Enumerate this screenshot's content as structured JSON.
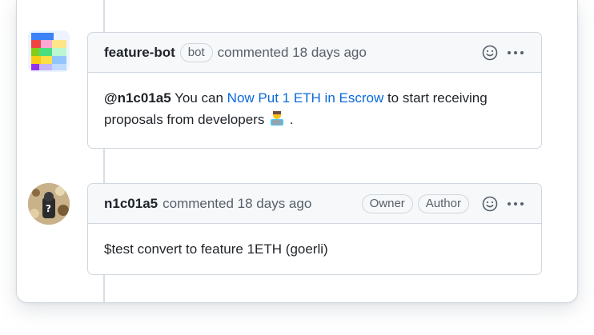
{
  "comments": [
    {
      "author": "feature-bot",
      "author_badge": "bot",
      "meta": "commented 18 days ago",
      "body": {
        "mention": "@n1c01a5",
        "text_before_link": " You can ",
        "link_text": "Now Put 1 ETH in Escrow",
        "text_after_link": " to start receiving proposals from developers ",
        "emoji": "technologist-emoji",
        "trailing": "."
      }
    },
    {
      "author": "n1c01a5",
      "meta": "commented 18 days ago",
      "badges": [
        "Owner",
        "Author"
      ],
      "body": {
        "text": "$test convert to feature 1ETH (goerli)"
      }
    }
  ],
  "icons": {
    "reaction": "smiley-icon",
    "more": "kebab-horizontal-icon"
  },
  "colors": {
    "link": "#0969da",
    "header_bg": "#f6f8fa",
    "border": "#d0d7de"
  }
}
